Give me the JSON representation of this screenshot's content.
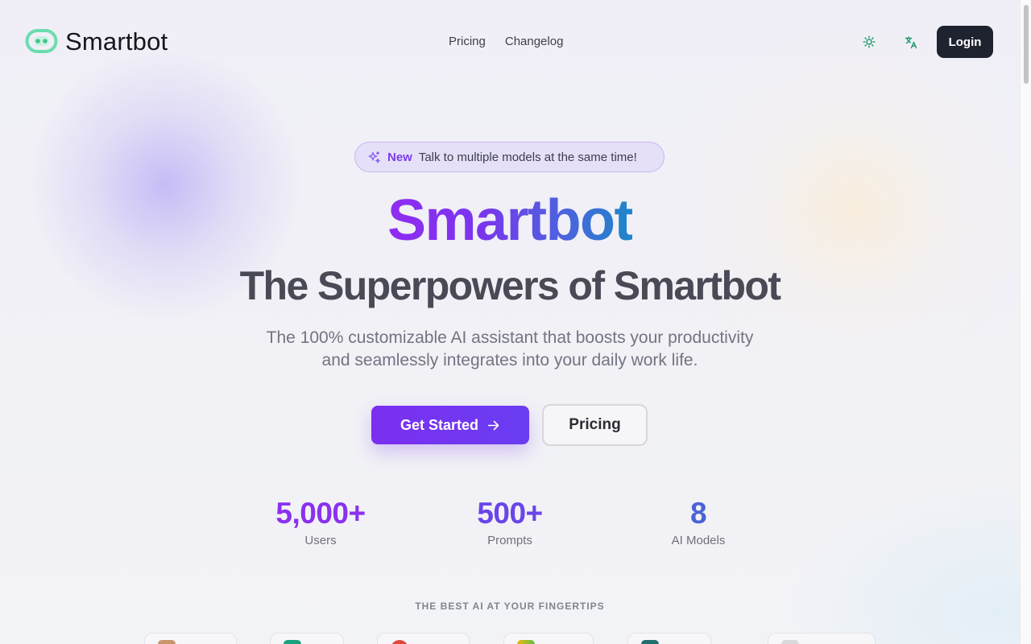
{
  "brand": {
    "name": "Smartbot",
    "accent": "#6cdcae"
  },
  "nav": {
    "items": [
      {
        "label": "Pricing"
      },
      {
        "label": "Changelog"
      }
    ]
  },
  "header": {
    "theme_icon": "sun-icon",
    "language_icon": "translate-icon",
    "login_label": "Login"
  },
  "badge": {
    "tag": "New",
    "text": "Talk to multiple models at the same time!",
    "icon": "sparkle-icon"
  },
  "hero": {
    "brand": "Smartbot",
    "title": "The Superpowers of Smartbot",
    "description_line1": "The 100% customizable AI assistant that boosts your productivity",
    "description_line2": "and seamlessly integrates into your daily work life."
  },
  "cta": {
    "primary_label": "Get Started",
    "primary_icon": "arrow-right-icon",
    "secondary_label": "Pricing"
  },
  "stats": [
    {
      "value": "5,000+",
      "label": "Users",
      "color": "#8a31ef"
    },
    {
      "value": "500+",
      "label": "Prompts",
      "color": "#6a45e8"
    },
    {
      "value": "8",
      "label": "AI Models",
      "color": "#4a64d6"
    }
  ],
  "models_section": {
    "label": "THE BEST AI AT YOUR FINGERTIPS"
  },
  "colors": {
    "primary": "#7c3aed",
    "dark": "#1f2330",
    "accent_green": "#6cdcae"
  }
}
